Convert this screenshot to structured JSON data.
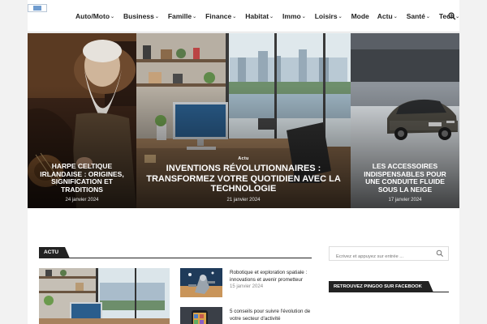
{
  "header": {
    "nav": [
      {
        "label": "Auto/Moto",
        "dropdown": true
      },
      {
        "label": "Business",
        "dropdown": true
      },
      {
        "label": "Famille",
        "dropdown": true
      },
      {
        "label": "Finance",
        "dropdown": true
      },
      {
        "label": "Habitat",
        "dropdown": true
      },
      {
        "label": "Immo",
        "dropdown": true
      },
      {
        "label": "Loisirs",
        "dropdown": true
      },
      {
        "label": "Mode",
        "dropdown": false
      },
      {
        "label": "Actu",
        "dropdown": true
      },
      {
        "label": "Santé",
        "dropdown": true
      },
      {
        "label": "Tech",
        "dropdown": true
      }
    ],
    "chevron": "⌄"
  },
  "hero": {
    "slides": [
      {
        "tag": "",
        "title": "Harpe celtique irlandaise : origines, signification et traditions",
        "date": "24 janvier 2024"
      },
      {
        "tag": "Actu",
        "title": "Inventions révolutionnaires : transformez votre quotidien avec la technologie",
        "date": "21 janvier 2024"
      },
      {
        "tag": "",
        "title": "Les accessoires indispensables pour une conduite fluide sous la neige",
        "date": "17 janvier 2024"
      }
    ]
  },
  "section": {
    "label": "ACTU",
    "items": [
      {
        "title": "Robotique et exploration spatiale : innovations et avenir prometteur",
        "date": "15 janvier 2024"
      },
      {
        "title": "5 conseils pour suivre l'évolution de votre secteur d'activité",
        "date": ""
      }
    ]
  },
  "sidebar": {
    "search_placeholder": "Ecrivez et appuyez sur entrée ...",
    "facebook_label": "RETROUVEZ PINGOO SUR FACEBOOK"
  },
  "colors": {
    "dark": "#222222",
    "accent": "#6f9ccf"
  }
}
